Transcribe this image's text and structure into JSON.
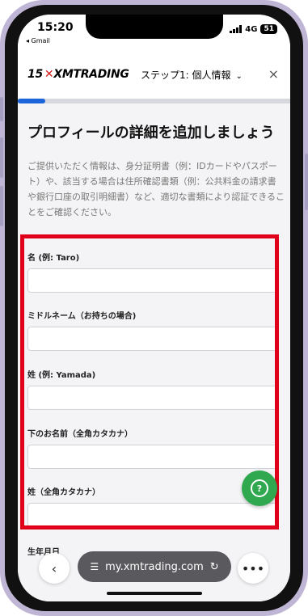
{
  "status": {
    "time": "15:20",
    "back_app": "◂ Gmail",
    "network": "4G",
    "battery": "51"
  },
  "header": {
    "logo_years": "15",
    "logo_text": "XMTRADING",
    "step_label": "ステップ1: 個人情報",
    "close_label": "×"
  },
  "progress": {
    "fraction": 0.1
  },
  "page": {
    "title": "プロフィールの詳細を追加しましょう",
    "description": "ご提供いただく情報は、身分証明書（例：IDカードやパスポート）や、該当する場合は住所確認書類（例：公共料金の請求書や銀行口座の取引明細書）など、適切な書類により認証できることをご確認ください。"
  },
  "form": {
    "fields": [
      {
        "label": "名 (例: Taro)",
        "value": ""
      },
      {
        "label": "ミドルネーム（お持ちの場合)",
        "value": ""
      },
      {
        "label": "姓 (例: Yamada)",
        "value": ""
      },
      {
        "label": "下のお名前（全角カタカナ）",
        "value": ""
      },
      {
        "label": "姓（全角カタカナ）",
        "value": ""
      }
    ],
    "dob_label": "生年月日"
  },
  "browser": {
    "url": "my.xmtrading.com",
    "back_icon": "chevron-left-icon",
    "more_icon": "more-icon"
  },
  "colors": {
    "highlight": "#e00019",
    "accent": "#1c64d9",
    "chat": "#2fa84f"
  }
}
